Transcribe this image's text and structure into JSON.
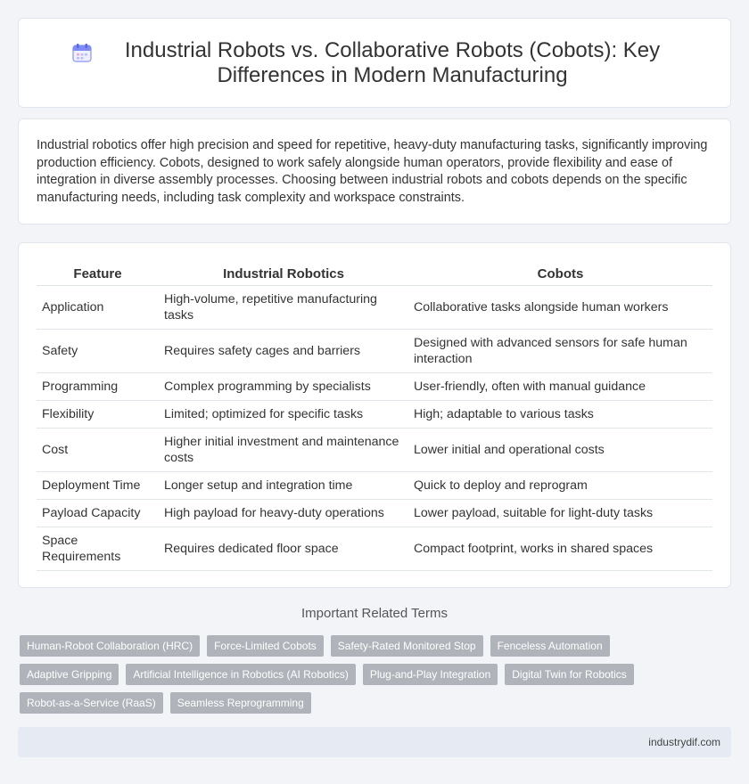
{
  "header": {
    "icon": "calendar-icon",
    "title": "Industrial Robots vs. Collaborative Robots (Cobots): Key Differences in Modern Manufacturing"
  },
  "summary": "Industrial robotics offer high precision and speed for repetitive, heavy-duty manufacturing tasks, significantly improving production efficiency. Cobots, designed to work safely alongside human operators, provide flexibility and ease of integration in diverse assembly processes. Choosing between industrial robots and cobots depends on the specific manufacturing needs, including task complexity and workspace constraints.",
  "table": {
    "headers": [
      "Feature",
      "Industrial Robotics",
      "Cobots"
    ],
    "rows": [
      [
        "Application",
        "High-volume, repetitive manufacturing tasks",
        "Collaborative tasks alongside human workers"
      ],
      [
        "Safety",
        "Requires safety cages and barriers",
        "Designed with advanced sensors for safe human interaction"
      ],
      [
        "Programming",
        "Complex programming by specialists",
        "User-friendly, often with manual guidance"
      ],
      [
        "Flexibility",
        "Limited; optimized for specific tasks",
        "High; adaptable to various tasks"
      ],
      [
        "Cost",
        "Higher initial investment and maintenance costs",
        "Lower initial and operational costs"
      ],
      [
        "Deployment Time",
        "Longer setup and integration time",
        "Quick to deploy and reprogram"
      ],
      [
        "Payload Capacity",
        "High payload for heavy-duty operations",
        "Lower payload, suitable for light-duty tasks"
      ],
      [
        "Space Requirements",
        "Requires dedicated floor space",
        "Compact footprint, works in shared spaces"
      ]
    ]
  },
  "related": {
    "title": "Important Related Terms",
    "tags": [
      "Human-Robot Collaboration (HRC)",
      "Force-Limited Cobots",
      "Safety-Rated Monitored Stop",
      "Fenceless Automation",
      "Adaptive Gripping",
      "Artificial Intelligence in Robotics (AI Robotics)",
      "Plug-and-Play Integration",
      "Digital Twin for Robotics",
      "Robot-as-a-Service (RaaS)",
      "Seamless Reprogramming"
    ]
  },
  "footer": {
    "site": "industrydif.com"
  }
}
